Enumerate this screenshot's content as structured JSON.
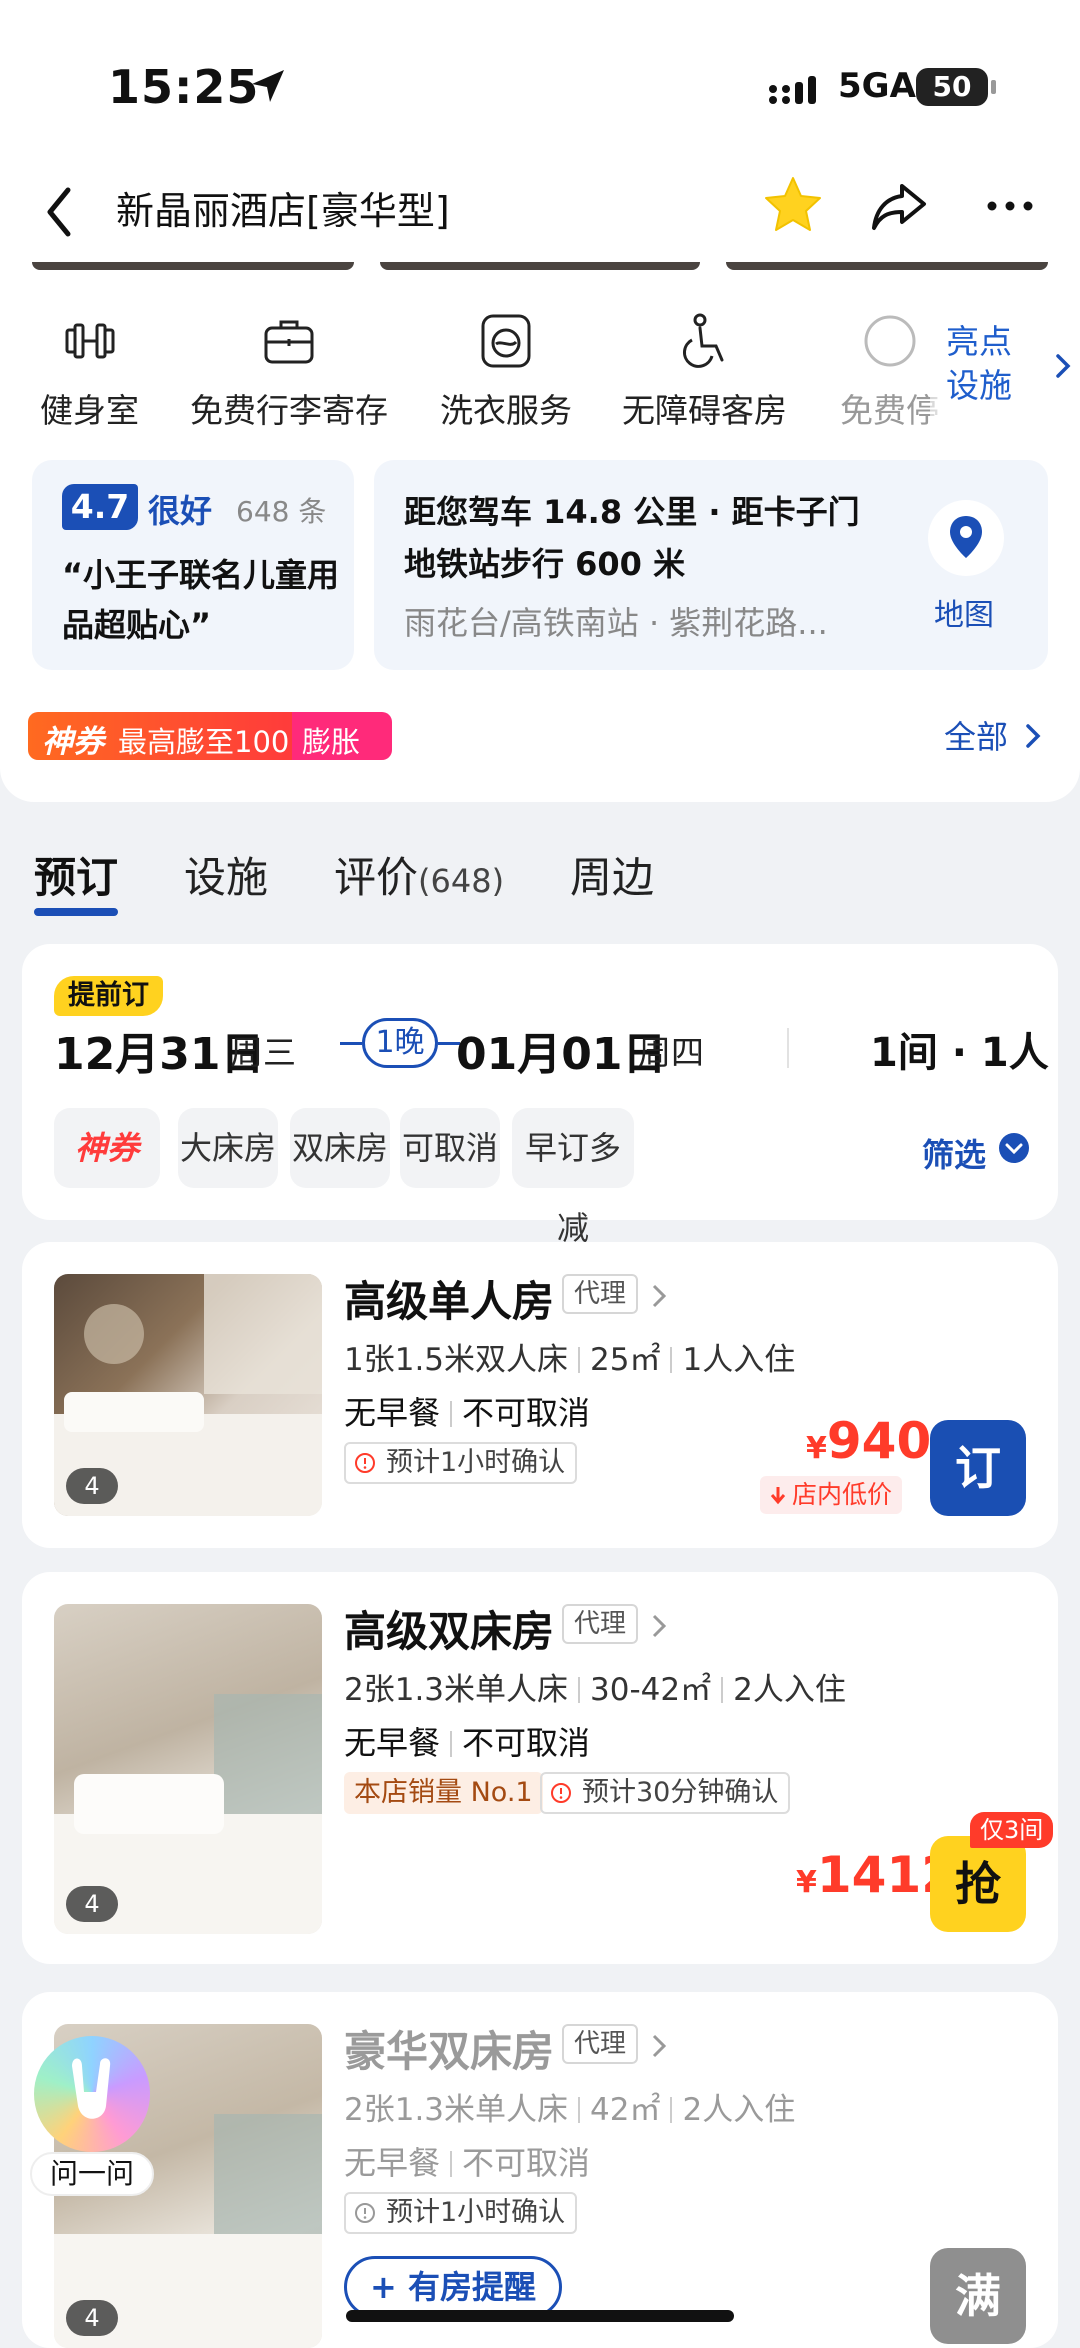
{
  "status_bar": {
    "time": "15:25",
    "network": "5GA",
    "battery": "50"
  },
  "header": {
    "title": "新晶丽酒店[豪华型]"
  },
  "facilities": [
    {
      "label": "健身室",
      "icon": "dumbbell-icon"
    },
    {
      "label": "免费行李寄存",
      "icon": "luggage-icon"
    },
    {
      "label": "洗衣服务",
      "icon": "washing-machine-icon"
    },
    {
      "label": "无障碍客房",
      "icon": "wheelchair-icon"
    },
    {
      "label": "免费停",
      "icon": "parking-icon"
    }
  ],
  "highlight": {
    "line1": "亮点",
    "line2": "设施"
  },
  "rating": {
    "score": "4.7",
    "level": "很好",
    "count": "648 条",
    "quote": "“小王子联名儿童用品超贴心”"
  },
  "location": {
    "line1": "距您驾车 14.8 公里 · 距卡子门地铁站步行 600 米",
    "line2": "雨花台/高铁南站 · 紫荆花路...",
    "map_label": "地图"
  },
  "coupon": {
    "brand": "神券",
    "text": "最高膨至100",
    "boost": "膨胀",
    "all_label": "全部"
  },
  "tabs": [
    {
      "label": "预订"
    },
    {
      "label": "设施"
    },
    {
      "label": "评价",
      "count": "(648)"
    },
    {
      "label": "周边"
    }
  ],
  "booking": {
    "badge": "提前订",
    "check_in_date": "12月31日",
    "check_in_weekday": "周三",
    "nights": "1晚",
    "check_out_date": "01月01日",
    "check_out_weekday": "周四",
    "guests": "1间 · 1人",
    "chips": [
      "神券",
      "大床房",
      "双床房",
      "可取消",
      "早订多减"
    ],
    "filter_label": "筛选"
  },
  "rooms": [
    {
      "name": "高级单人房",
      "agent": "代理",
      "beds": "1张1.5米双人床",
      "area": "25㎡",
      "occupancy": "1人入住",
      "breakfast": "无早餐",
      "cancel": "不可取消",
      "confirm": "预计1小时确认",
      "currency": "¥",
      "price": "940",
      "low_tag": "店内低价",
      "button": "订",
      "photo_count": "4"
    },
    {
      "name": "高级双床房",
      "agent": "代理",
      "beds": "2张1.3米单人床",
      "area": "30-42㎡",
      "occupancy": "2人入住",
      "breakfast": "无早餐",
      "cancel": "不可取消",
      "sales": "本店销量 No.1",
      "confirm": "预计30分钟确认",
      "currency": "¥",
      "price": "1412",
      "only_tag": "仅3间",
      "button": "抢",
      "photo_count": "4"
    },
    {
      "name": "豪华双床房",
      "agent": "代理",
      "beds": "2张1.3米单人床",
      "area": "42㎡",
      "occupancy": "2人入住",
      "breakfast": "无早餐",
      "cancel": "不可取消",
      "confirm": "预计1小时确认",
      "remind": "有房提醒",
      "button": "满",
      "photo_count": "4"
    }
  ],
  "assistant": {
    "label": "问一问"
  },
  "colors": {
    "brand_blue": "#1b4fb6",
    "price_red": "#ff3b2a",
    "grab_yellow": "#ffd21f"
  }
}
